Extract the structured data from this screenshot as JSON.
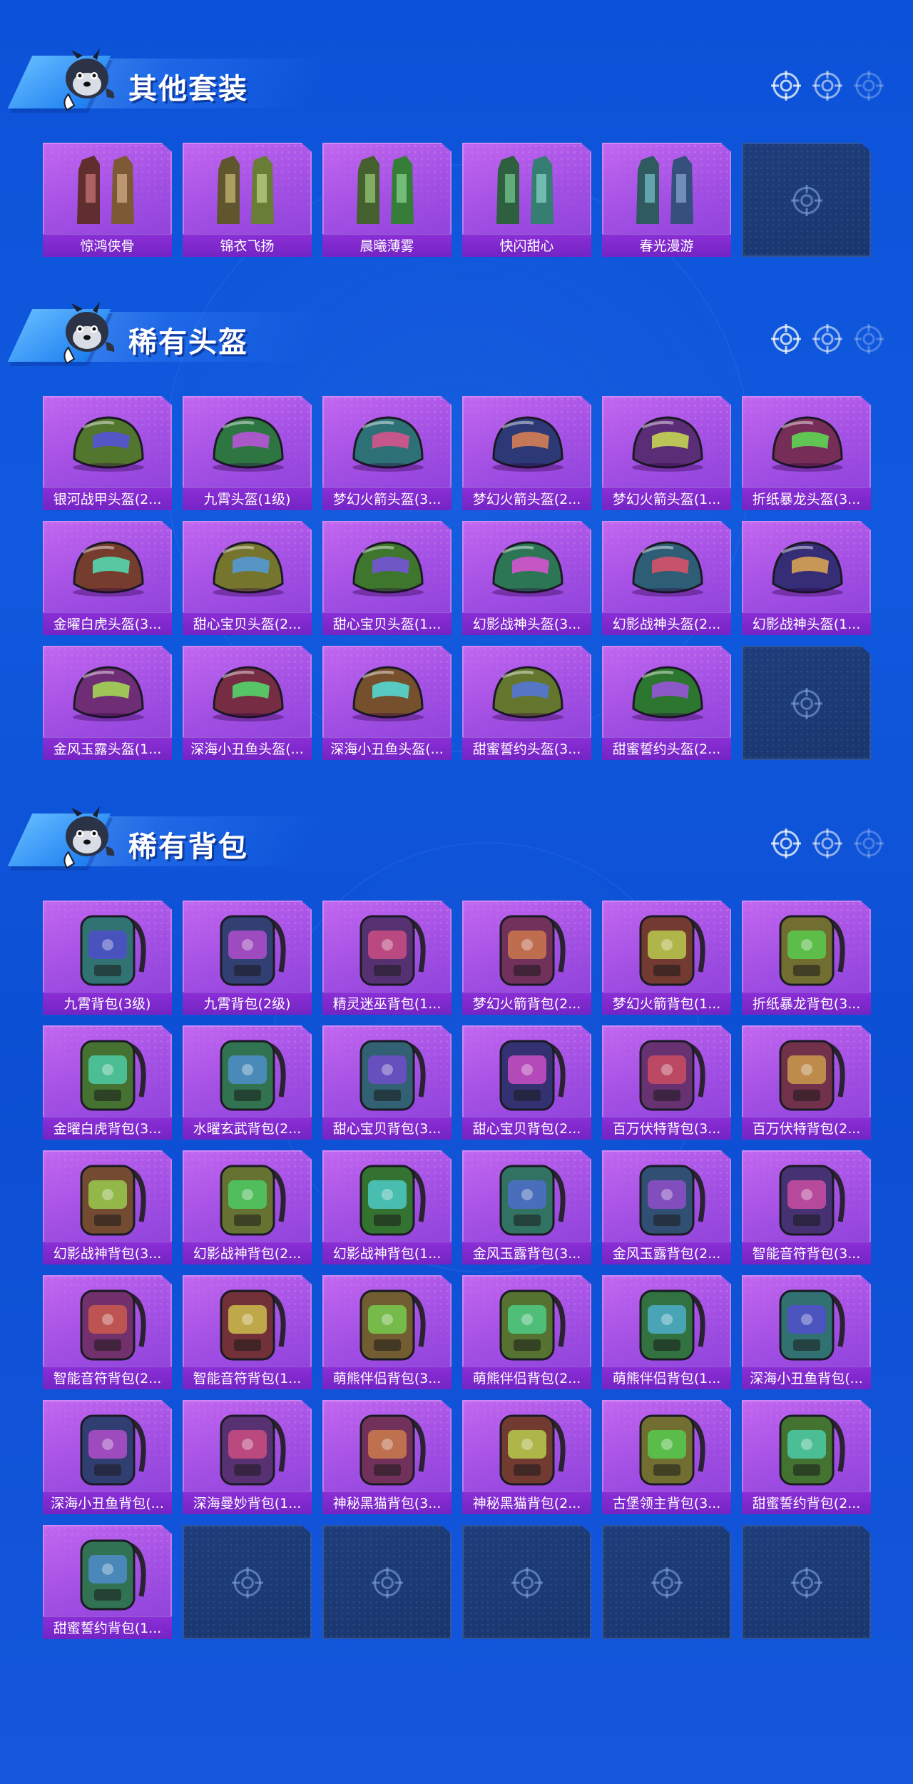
{
  "sections": [
    {
      "title": "其他套装",
      "items": [
        "惊鸿侠骨",
        "锦衣飞扬",
        "晨曦薄雾",
        "快闪甜心",
        "春光漫游"
      ],
      "empty_slots": 1
    },
    {
      "title": "稀有头盔",
      "items": [
        "银河战甲头盔(2...",
        "九霄头盔(1级)",
        "梦幻火箭头盔(3...",
        "梦幻火箭头盔(2...",
        "梦幻火箭头盔(1...",
        "折纸暴龙头盔(3...",
        "金曜白虎头盔(3...",
        "甜心宝贝头盔(2...",
        "甜心宝贝头盔(1...",
        "幻影战神头盔(3...",
        "幻影战神头盔(2...",
        "幻影战神头盔(1...",
        "金风玉露头盔(1...",
        "深海小丑鱼头盔(...",
        "深海小丑鱼头盔(...",
        "甜蜜誓约头盔(3...",
        "甜蜜誓约头盔(2..."
      ],
      "empty_slots": 1
    },
    {
      "title": "稀有背包",
      "items": [
        "九霄背包(3级)",
        "九霄背包(2级)",
        "精灵迷巫背包(1...",
        "梦幻火箭背包(2...",
        "梦幻火箭背包(1...",
        "折纸暴龙背包(3...",
        "金曜白虎背包(3...",
        "水曜玄武背包(2...",
        "甜心宝贝背包(3...",
        "甜心宝贝背包(2...",
        "百万伏特背包(3...",
        "百万伏特背包(2...",
        "幻影战神背包(3...",
        "幻影战神背包(2...",
        "幻影战神背包(1...",
        "金风玉露背包(3...",
        "金风玉露背包(2...",
        "智能音符背包(3...",
        "智能音符背包(2...",
        "智能音符背包(1...",
        "萌熊伴侣背包(3...",
        "萌熊伴侣背包(2...",
        "萌熊伴侣背包(1...",
        "深海小丑鱼背包(...",
        "深海小丑鱼背包(...",
        "深海曼妙背包(1...",
        "神秘黑猫背包(3...",
        "神秘黑猫背包(2...",
        "古堡领主背包(3...",
        "甜蜜誓约背包(2...",
        "甜蜜誓约背包(1..."
      ],
      "empty_slots": 5
    }
  ],
  "colors": {
    "background": "#0c52d8",
    "card_purple": "#a24fe3",
    "label_purple": "#7c28c8",
    "empty_card": "#1e3d7a"
  },
  "icons": [
    "mascot-dog-icon",
    "crosshair-target-icon"
  ]
}
